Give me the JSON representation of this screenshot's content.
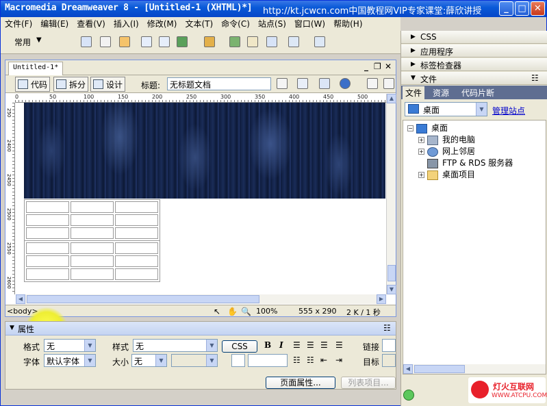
{
  "window": {
    "title": "Macromedia Dreamweaver 8 - [Untitled-1 (XHTML)*]",
    "overlay_url": "http://kt.jcwcn.com中国教程网VIP专家课堂:薛欣讲授"
  },
  "menu": [
    "文件(F)",
    "编辑(E)",
    "查看(V)",
    "插入(I)",
    "修改(M)",
    "文本(T)",
    "命令(C)",
    "站点(S)",
    "窗口(W)",
    "帮助(H)"
  ],
  "insert_bar": {
    "category": "常用"
  },
  "document": {
    "tab": "Untitled-1*",
    "views": [
      "代码",
      "拆分",
      "设计"
    ],
    "title_label": "标题:",
    "title_value": "无标题文档",
    "ruler_h": [
      "0",
      "50",
      "100",
      "150",
      "200",
      "250",
      "300",
      "350",
      "400",
      "450",
      "500"
    ],
    "ruler_v": [
      "250",
      "2400",
      "2450",
      "2500",
      "2550",
      "2600"
    ],
    "status": {
      "tag": "<body>",
      "zoom": "100%",
      "size": "555 x 290",
      "weight": "2 K / 1 秒"
    }
  },
  "properties": {
    "header": "属性",
    "format_label": "格式",
    "format_value": "无",
    "style_label": "样式",
    "style_value": "无",
    "css_button": "CSS",
    "bold": "B",
    "italic": "I",
    "link_label": "链接",
    "font_label": "字体",
    "font_value": "默认字体",
    "size_label": "大小",
    "size_value": "无",
    "target_label": "目标",
    "page_props_button": "页面属性...",
    "list_item_button": "列表项目..."
  },
  "right_panel": {
    "groups": [
      "CSS",
      "应用程序",
      "标签检查器",
      "文件"
    ],
    "file_tabs": [
      "文件",
      "资源",
      "代码片断"
    ],
    "site_select": "桌面",
    "manage_sites": "管理站点",
    "tree": {
      "root": "桌面",
      "children": [
        "我的电脑",
        "网上邻居",
        "FTP & RDS 服务器",
        "桌面项目"
      ]
    }
  },
  "watermark": {
    "name": "灯火互联网",
    "url": "WWW.ATCPU.COM"
  }
}
